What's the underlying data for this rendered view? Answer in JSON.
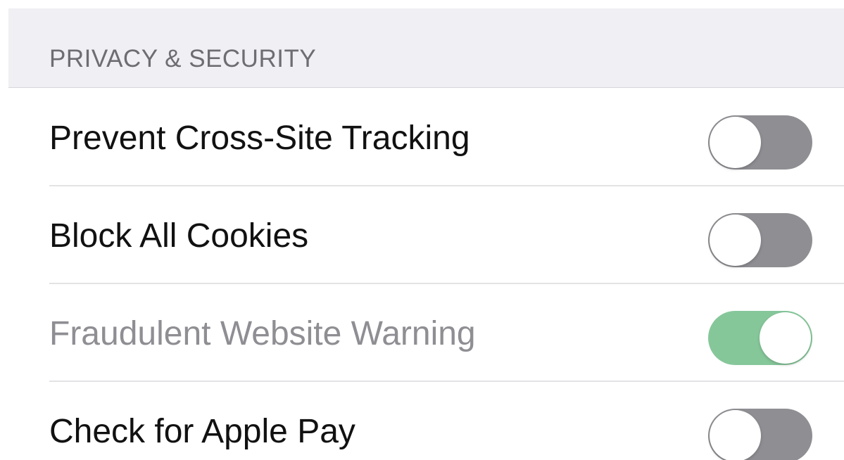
{
  "section": {
    "header": "PRIVACY & SECURITY"
  },
  "rows": [
    {
      "label": "Prevent Cross-Site Tracking",
      "toggle_state": "off",
      "enabled": true
    },
    {
      "label": "Block All Cookies",
      "toggle_state": "off",
      "enabled": true
    },
    {
      "label": "Fraudulent Website Warning",
      "toggle_state": "on",
      "enabled": false
    },
    {
      "label": "Check for Apple Pay",
      "toggle_state": "off",
      "enabled": true
    }
  ],
  "colors": {
    "header_background": "#efeff4",
    "header_text": "#6d6d72",
    "toggle_off": "#8e8e93",
    "toggle_on_dimmed": "#86c79a",
    "label_text": "#111111",
    "disabled_label_text": "#8e8e93"
  }
}
